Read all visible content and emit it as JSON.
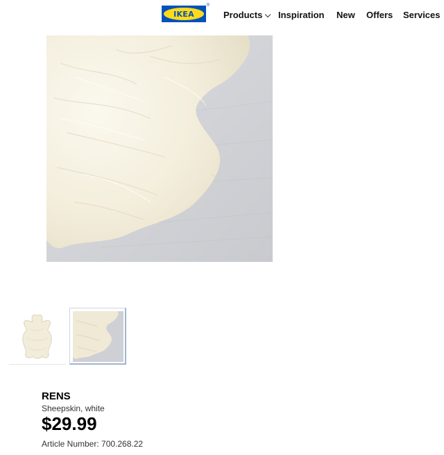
{
  "header": {
    "logo_text": "IKEA",
    "logo_reg": "®",
    "nav": {
      "products": "Products",
      "inspiration": "Inspiration",
      "new": "New",
      "offers": "Offers",
      "services": "Services"
    }
  },
  "icons": {
    "products_dropdown": "chevron-down-icon"
  },
  "colors": {
    "ikea_blue": "#0051ba",
    "ikea_yellow": "#ffda1a",
    "floor": "#d7d8dc",
    "fur": "#f5f1e4"
  },
  "gallery": {
    "selected_thumbnail": 2
  },
  "product": {
    "name": "RENS",
    "description": "Sheepskin, white",
    "price": "$29.99",
    "article_label": "Article Number:",
    "article_number": "700.268.22"
  }
}
